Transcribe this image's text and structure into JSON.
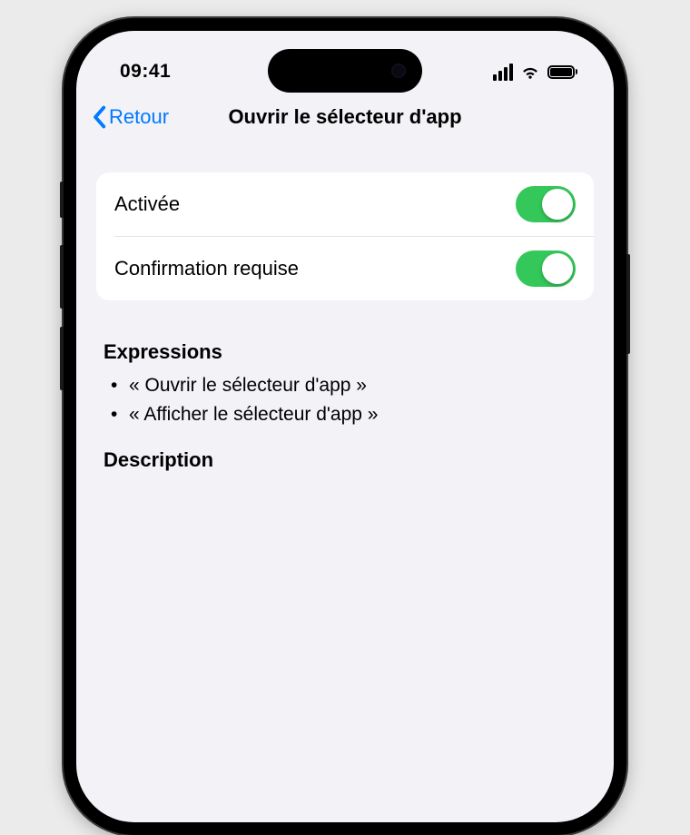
{
  "status": {
    "time": "09:41"
  },
  "nav": {
    "back_label": "Retour",
    "title": "Ouvrir le sélecteur d'app"
  },
  "settings": {
    "enabled_label": "Activée",
    "enabled_on": true,
    "confirmation_label": "Confirmation requise",
    "confirmation_on": true
  },
  "expressions": {
    "heading": "Expressions",
    "items": [
      "« Ouvrir le sélecteur d'app »",
      "« Afficher le sélecteur d'app »"
    ]
  },
  "description": {
    "heading": "Description"
  },
  "colors": {
    "accent": "#007aff",
    "switch_on": "#34c759",
    "background": "#f2f2f7"
  }
}
